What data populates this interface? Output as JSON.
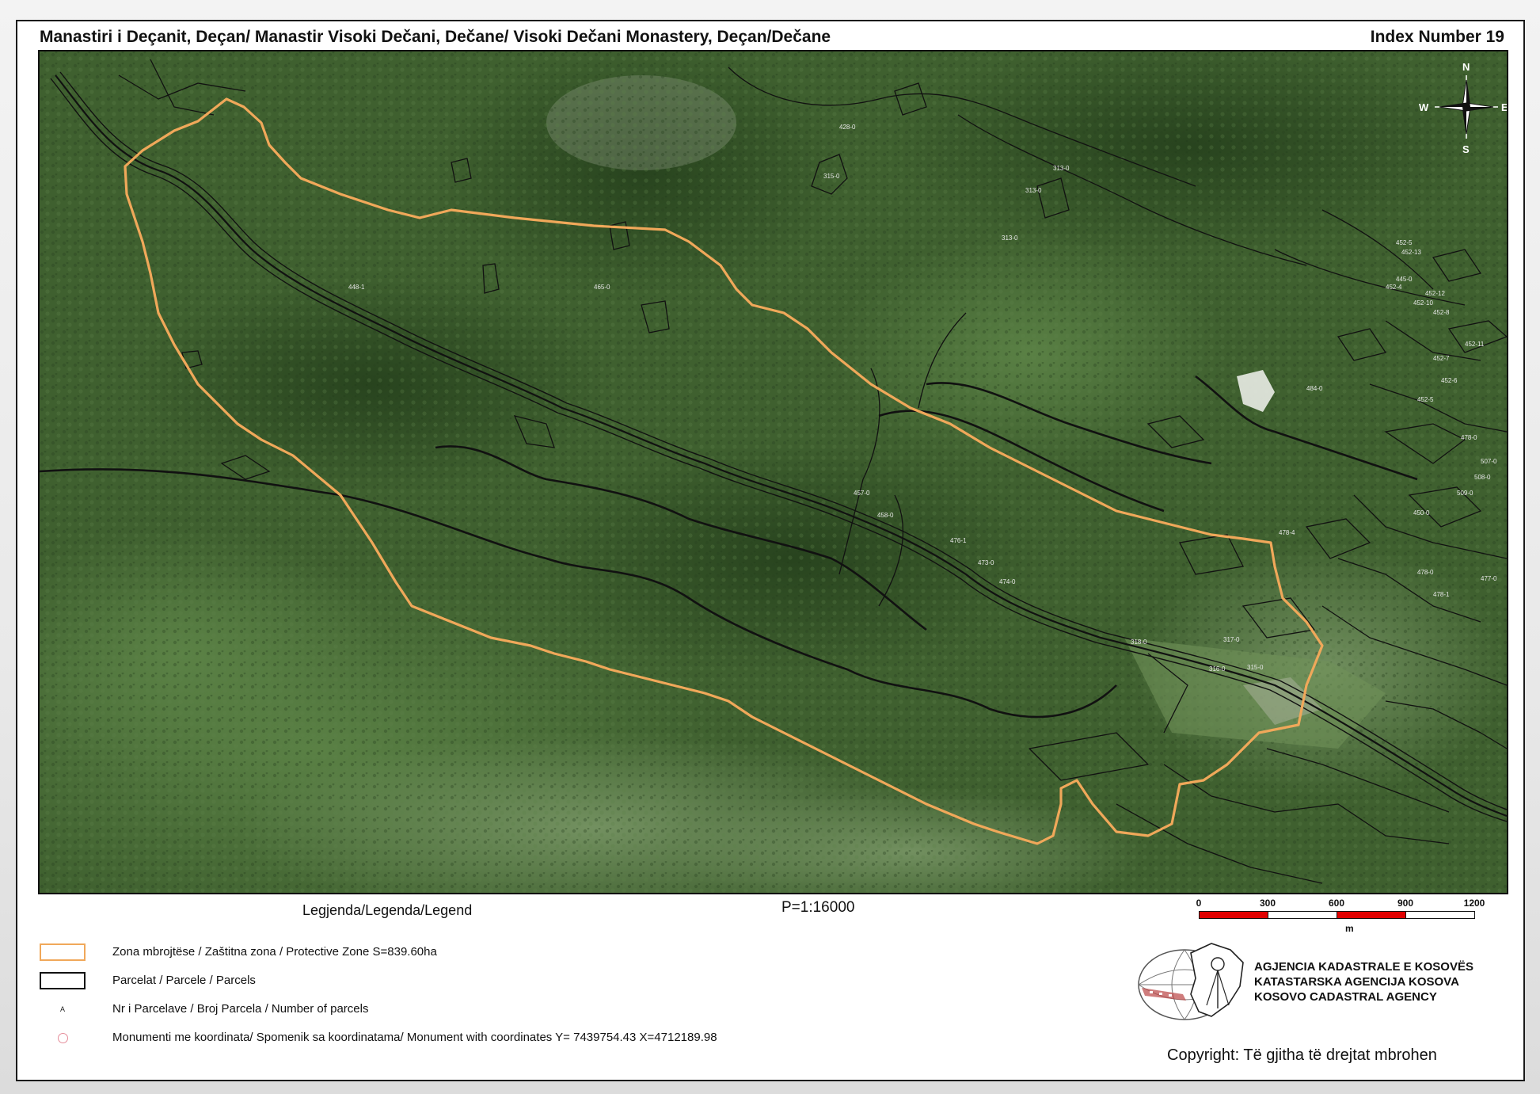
{
  "header": {
    "title": "Manastiri i Deçanit, Deçan/ Manastir Visoki Dečani, Dečane/ Visoki Dečani Monastery, Deçan/Dečane",
    "index": "Index Number 19"
  },
  "compass": {
    "n": "N",
    "s": "S",
    "e": "E",
    "w": "W"
  },
  "map_labels": [
    "428-0",
    "313-0",
    "315-0",
    "313-0",
    "313-0",
    "445-0",
    "450-0",
    "452-5",
    "452-13",
    "452-4",
    "452-12",
    "452-10",
    "452-8",
    "452-11",
    "452-7",
    "452-6",
    "452-5",
    "478-0",
    "478-0",
    "478-1",
    "478-4",
    "484-0",
    "477-0",
    "457-0",
    "458-0",
    "476-1",
    "473-0",
    "474-0",
    "317-0",
    "316-0",
    "315-0",
    "318-0",
    "507-0",
    "508-0",
    "509-0",
    "448-1",
    "465-0"
  ],
  "colors": {
    "protective_zone": "#f0a85a",
    "parcel_line": "#111111",
    "scale_red": "#e00000",
    "monument": "#e58d9a",
    "forest_dark": "#2f4d24",
    "forest_mid": "#456b34",
    "forest_light": "#6a8f55"
  },
  "legend": {
    "title": "Legjenda/Legenda/Legend",
    "items": [
      {
        "symbol": "protective-zone",
        "label": "Zona mbrojtëse / Zaštitna zona / Protective  Zone  S=839.60ha"
      },
      {
        "symbol": "parcel",
        "label": "Parcelat / Parcele / Parcels"
      },
      {
        "symbol": "parcel-number",
        "symbol_text": "A",
        "label": "Nr i Parcelave / Broj Parcela / Number of parcels"
      },
      {
        "symbol": "monument",
        "label": "Monumenti me koordinata/ Spomenik sa koordinatama/ Monument with coordinates Y= 7439754.43  X=4712189.98"
      }
    ]
  },
  "scale": {
    "ratio": "P=1:16000",
    "ticks": [
      "0",
      "300",
      "600",
      "900",
      "1200"
    ],
    "unit": "m"
  },
  "agency": {
    "lines": [
      "AGJENCIA KADASTRALE E KOSOVËS",
      "KATASTARSKA AGENCIJA KOSOVA",
      "KOSOVO CADASTRAL AGENCY"
    ]
  },
  "copyright": "Copyright: Të gjitha të drejtat mbrohen"
}
